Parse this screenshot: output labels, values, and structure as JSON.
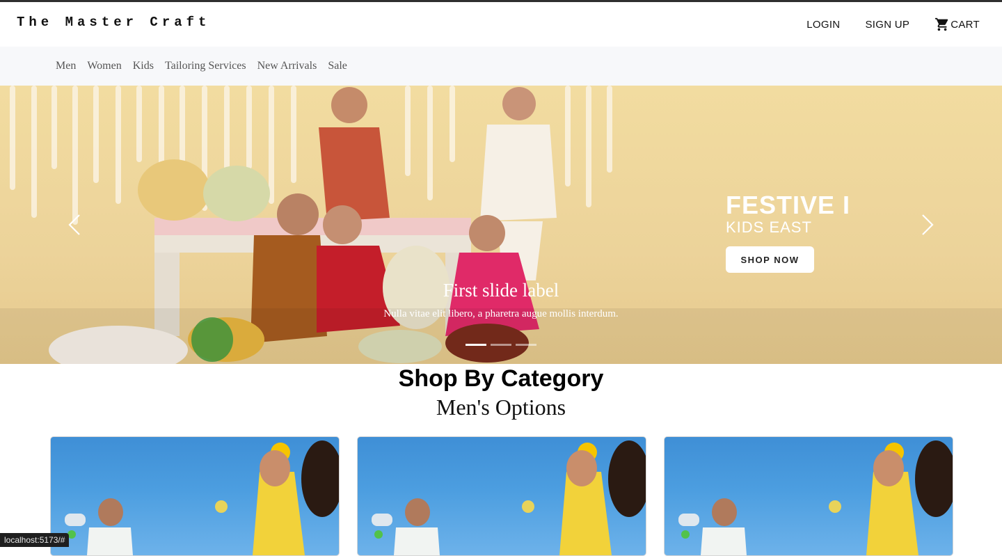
{
  "header": {
    "brand": "The Master Craft",
    "login_label": "LOGIN",
    "signup_label": "SIGN UP",
    "cart_label": "CART"
  },
  "categories_nav": [
    "Men",
    "Women",
    "Kids",
    "Tailoring Services",
    "New Arrivals",
    "Sale"
  ],
  "hero": {
    "promo_title": "FESTIVE I",
    "promo_subtitle": "KIDS EAST",
    "promo_button": "SHOP NOW",
    "caption_title": "First slide label",
    "caption_text": "Nulla vitae elit libero, a pharetra augue mollis interdum.",
    "slide_count": 3,
    "active_slide": 1
  },
  "section": {
    "title": "Shop By Category",
    "subtitle": "Men's Options",
    "card_count": 3
  },
  "status_bar": {
    "url": "localhost:5173/#"
  },
  "colors": {
    "nav_bg": "#f7f8fa",
    "hero_bg": "#ecd39a",
    "card_sky": "#4c9ee0",
    "text": "#111111"
  }
}
